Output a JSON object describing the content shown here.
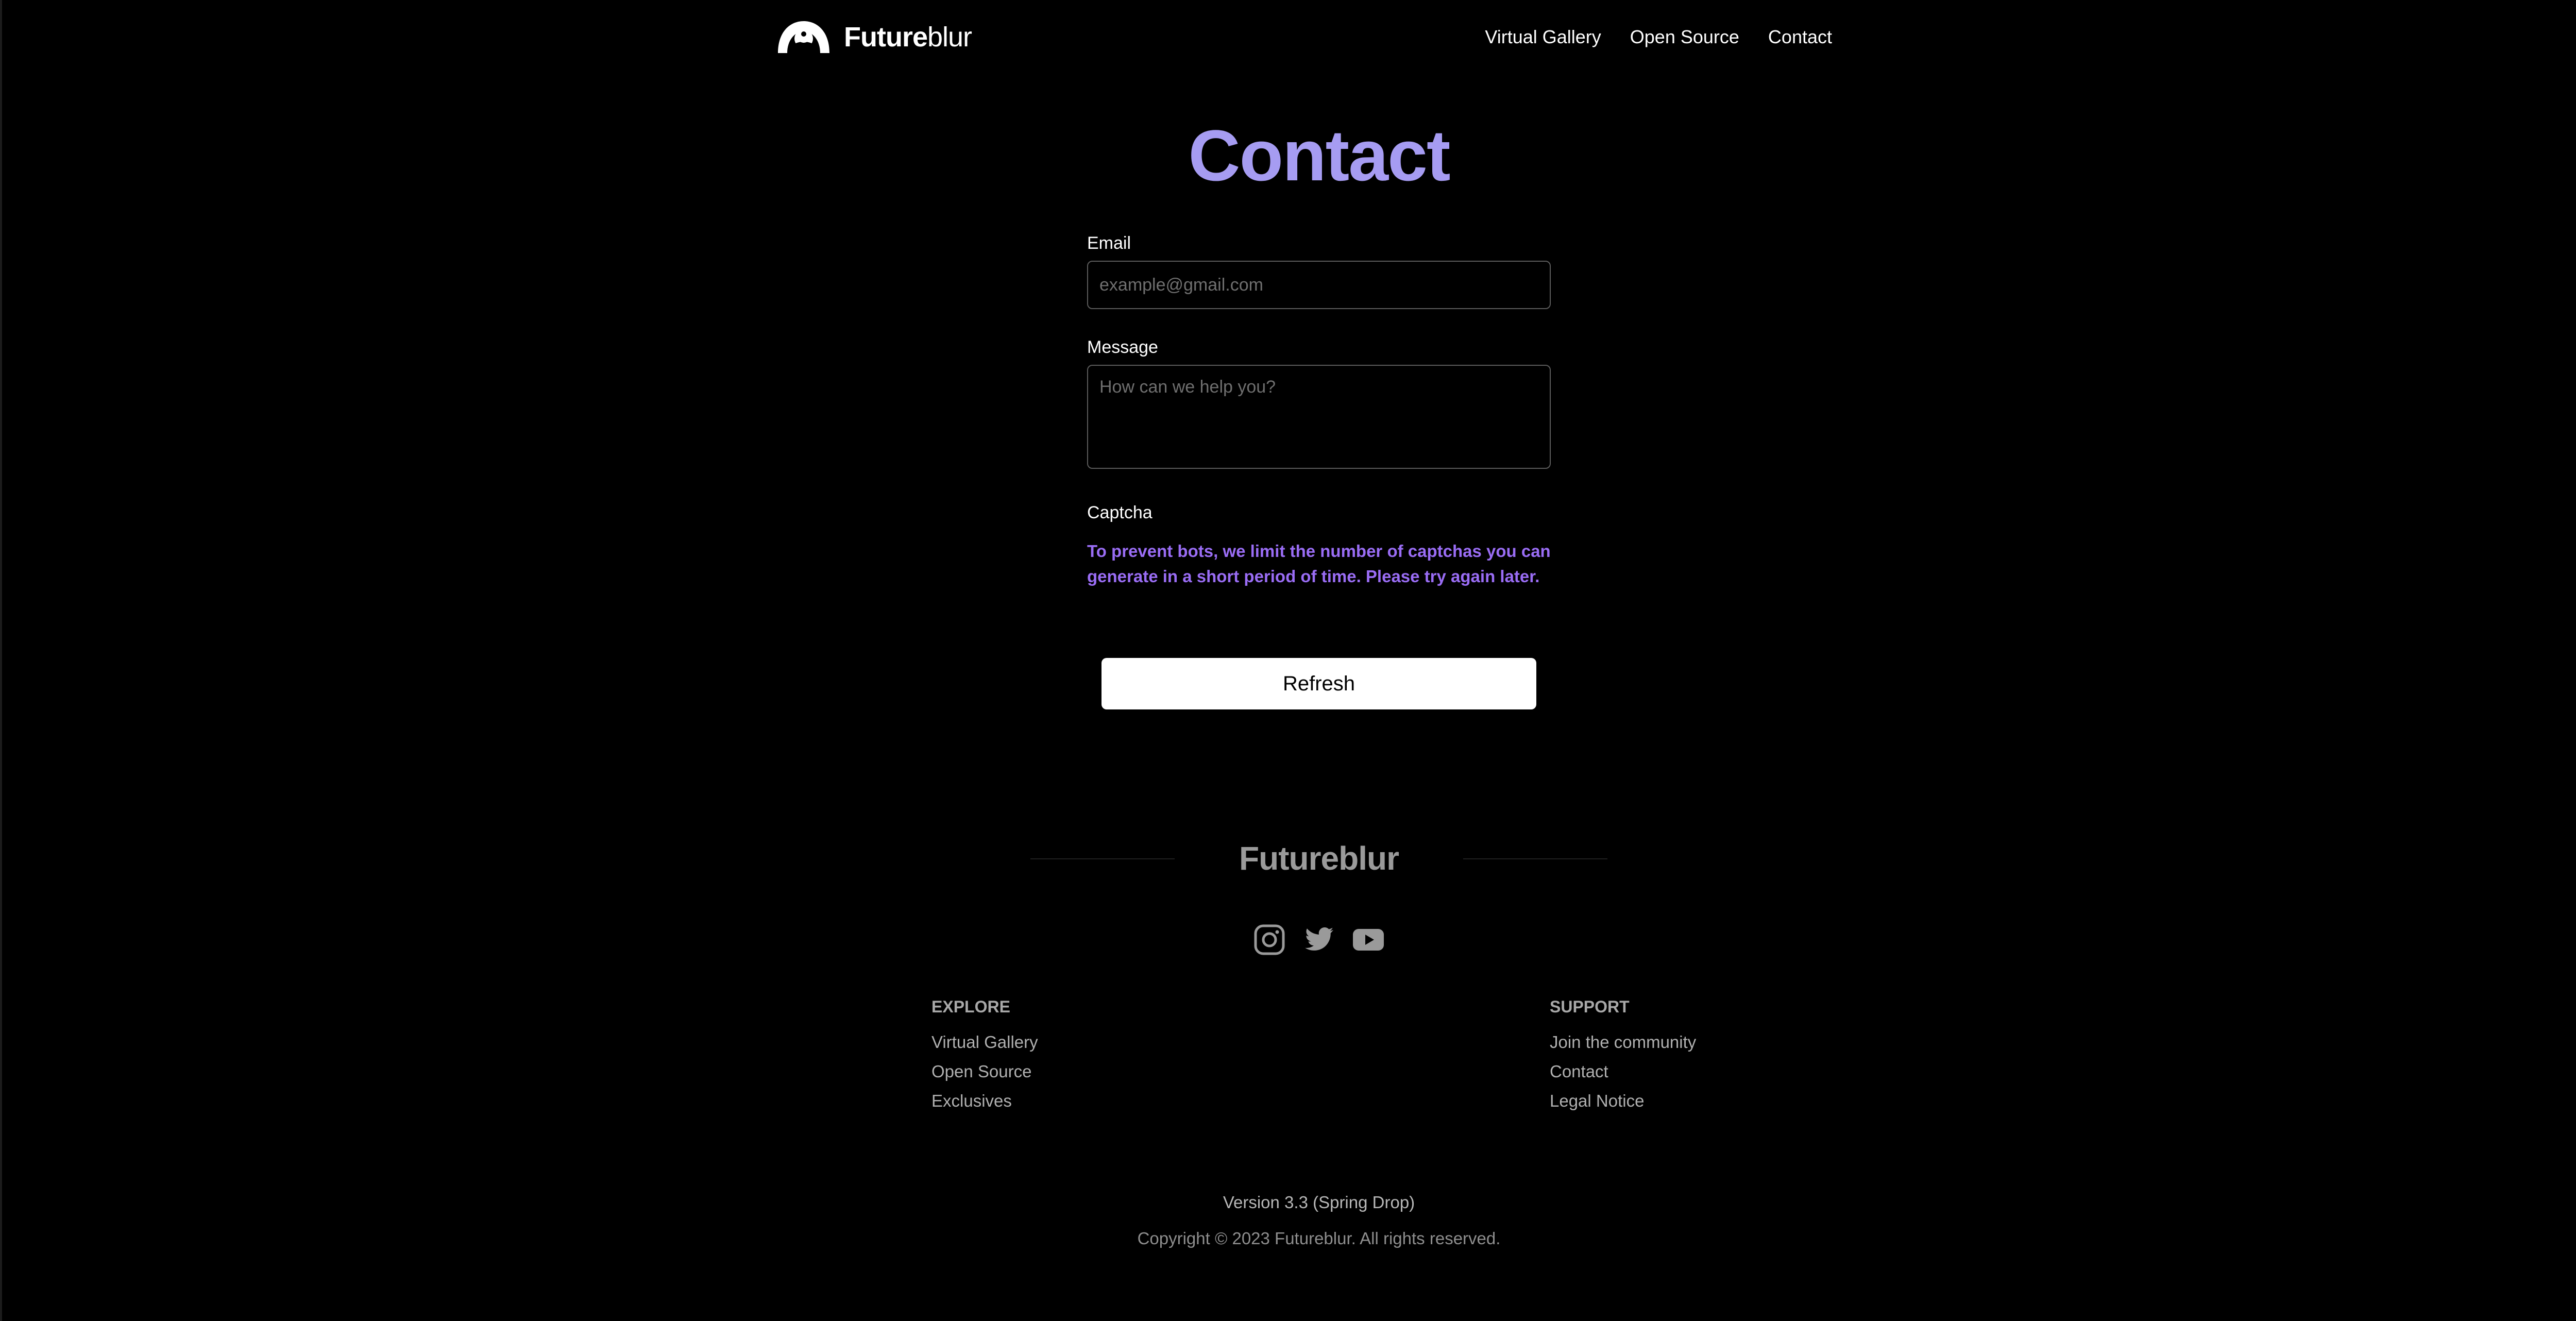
{
  "header": {
    "brand_bold": "Future",
    "brand_light": "blur",
    "nav": [
      {
        "label": "Virtual Gallery"
      },
      {
        "label": "Open Source"
      },
      {
        "label": "Contact"
      }
    ]
  },
  "main": {
    "title": "Contact",
    "email": {
      "label": "Email",
      "placeholder": "example@gmail.com",
      "value": ""
    },
    "message": {
      "label": "Message",
      "placeholder": "How can we help you?",
      "value": ""
    },
    "captcha": {
      "label": "Captcha",
      "notice": "To prevent bots, we limit the number of captchas you can generate in a short period of time. Please try again later."
    },
    "refresh_label": "Refresh"
  },
  "footer": {
    "brand": "Futureblur",
    "social": [
      {
        "icon": "instagram-icon"
      },
      {
        "icon": "twitter-icon"
      },
      {
        "icon": "youtube-icon"
      }
    ],
    "explore": {
      "heading": "EXPLORE",
      "links": [
        "Virtual Gallery",
        "Open Source",
        "Exclusives"
      ]
    },
    "support": {
      "heading": "SUPPORT",
      "links": [
        "Join the community",
        "Contact",
        "Legal Notice"
      ]
    },
    "version": "Version 3.3 (Spring Drop)",
    "copyright": "Copyright © 2023 Futureblur. All rights reserved."
  },
  "colors": {
    "background": "#000000",
    "accent_title": "#a69cf2",
    "accent_notice": "#9a6df5",
    "footer_text": "#9a9a9a"
  }
}
